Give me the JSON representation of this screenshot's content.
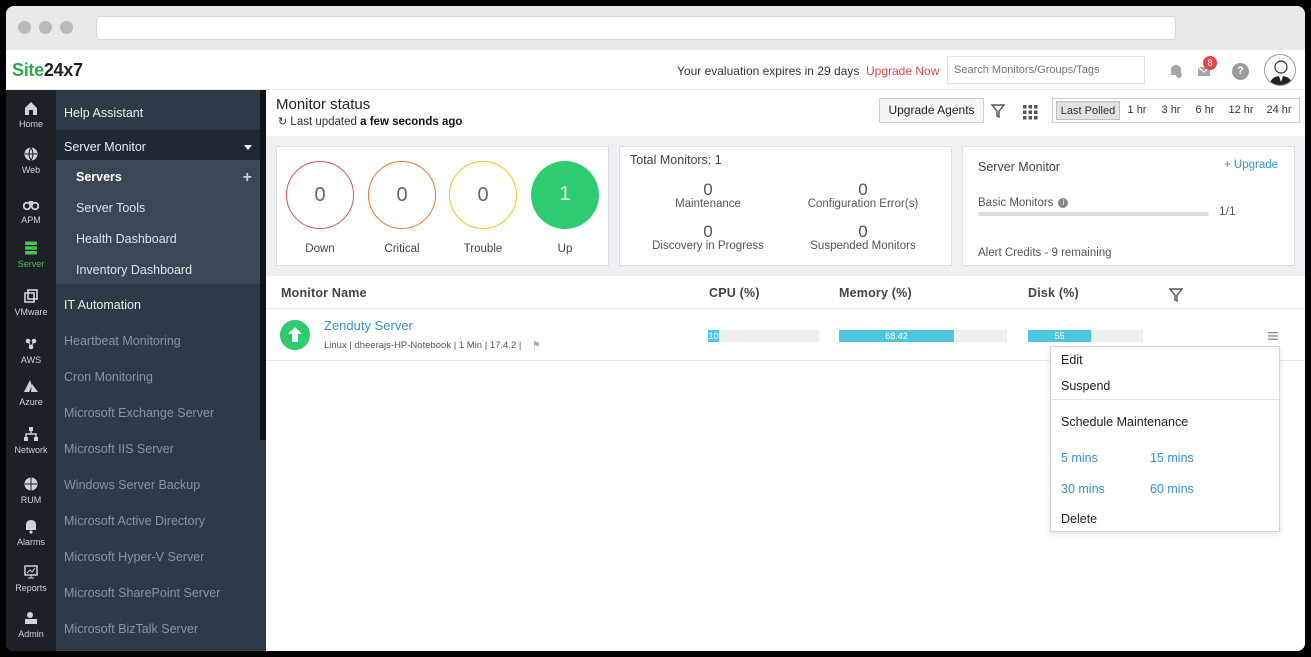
{
  "brand": {
    "logo_site": "Site",
    "logo_num": "24x7"
  },
  "header": {
    "evaluation": "Your evaluation expires in 29 days",
    "upgrade_now": "Upgrade Now",
    "search_placeholder": "Search Monitors/Groups/Tags",
    "notification_count": "8",
    "help": "?"
  },
  "rail": [
    {
      "label": "Home",
      "icon": "home-icon"
    },
    {
      "label": "Web",
      "icon": "globe-icon"
    },
    {
      "label": "APM",
      "icon": "binoculars-icon"
    },
    {
      "label": "Server",
      "icon": "server-icon",
      "active": true
    },
    {
      "label": "VMware",
      "icon": "vmware-icon"
    },
    {
      "label": "AWS",
      "icon": "aws-icon"
    },
    {
      "label": "Azure",
      "icon": "azure-icon"
    },
    {
      "label": "Network",
      "icon": "network-icon"
    },
    {
      "label": "RUM",
      "icon": "rum-icon"
    },
    {
      "label": "Alarms",
      "icon": "bell-icon"
    },
    {
      "label": "Reports",
      "icon": "reports-icon"
    },
    {
      "label": "Admin",
      "icon": "admin-icon"
    }
  ],
  "subnav": {
    "help_assistant": "Help Assistant",
    "server_monitor": "Server Monitor",
    "servers": "Servers",
    "server_tools": "Server Tools",
    "health_dashboard": "Health Dashboard",
    "inventory_dashboard": "Inventory Dashboard",
    "it_automation": "IT Automation",
    "dim_items": [
      "Heartbeat Monitoring",
      "Cron Monitoring",
      "Microsoft Exchange Server",
      "Microsoft IIS Server",
      "Windows Server Backup",
      "Microsoft Active Directory",
      "Microsoft Hyper-V Server",
      "Microsoft SharePoint Server",
      "Microsoft BizTalk Server"
    ]
  },
  "main": {
    "title": "Monitor status",
    "last_updated_prefix": "Last updated",
    "last_updated_value": "a few seconds ago",
    "upgrade_agents": "Upgrade Agents",
    "periods": [
      "Last Polled",
      "1 hr",
      "3 hr",
      "6 hr",
      "12 hr",
      "24 hr"
    ],
    "selected_period": "Last Polled"
  },
  "status": [
    {
      "label": "Down",
      "value": "0",
      "color": "#d9534f"
    },
    {
      "label": "Critical",
      "value": "0",
      "color": "#e8762c"
    },
    {
      "label": "Trouble",
      "value": "0",
      "color": "#f0c419"
    },
    {
      "label": "Up",
      "value": "1",
      "color": "#2ecc71"
    }
  ],
  "total": {
    "title": "Total Monitors: 1",
    "maintenance": {
      "value": "0",
      "label": "Maintenance"
    },
    "config_error": {
      "value": "0",
      "label": "Configuration Error(s)"
    },
    "discovery": {
      "value": "0",
      "label": "Discovery in Progress"
    },
    "suspended": {
      "value": "0",
      "label": "Suspended Monitors"
    }
  },
  "server_monitor_card": {
    "title": "Server Monitor",
    "upgrade": "+ Upgrade",
    "basic": "Basic Monitors",
    "count": "1/1",
    "credits": "Alert Credits - 9 remaining"
  },
  "table": {
    "headers": {
      "name": "Monitor Name",
      "cpu": "CPU (%)",
      "memory": "Memory (%)",
      "disk": "Disk (%)"
    },
    "rows": [
      {
        "name": "Zenduty Server",
        "meta": "Linux | dheerajs-HP-Notebook | 1 Min | 17.4.2 |",
        "cpu": "10",
        "memory": "68.42",
        "disk": "55"
      }
    ]
  },
  "menu": {
    "edit": "Edit",
    "suspend": "Suspend",
    "schedule": "Schedule Maintenance",
    "durations": [
      "5 mins",
      "15 mins",
      "30 mins",
      "60 mins"
    ],
    "delete": "Delete"
  },
  "colors": {
    "accent": "#2fa84f",
    "link": "#3a8fd1",
    "bar": "#4fc6e0"
  }
}
